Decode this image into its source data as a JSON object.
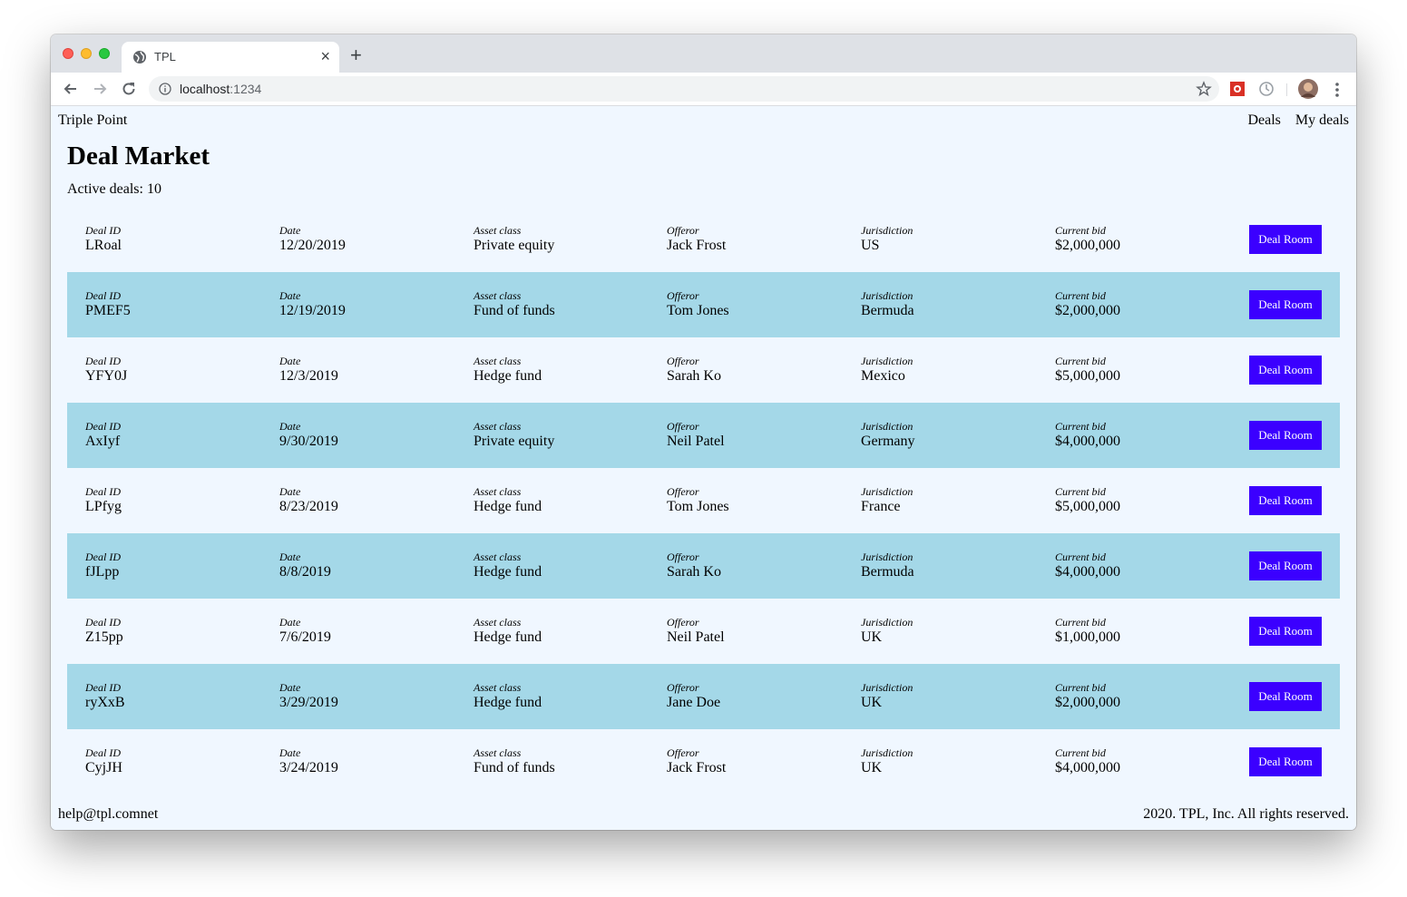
{
  "browser": {
    "tab_title": "TPL",
    "tab_close": "×",
    "new_tab": "+",
    "url_host": "localhost",
    "url_port": ":1234"
  },
  "page": {
    "brand": "Triple Point",
    "nav": [
      "Deals",
      "My deals"
    ],
    "heading": "Deal Market",
    "active_deals": "Active deals: 10",
    "labels": {
      "deal_id": "Deal ID",
      "date": "Date",
      "asset_class": "Asset class",
      "offeror": "Offeror",
      "jurisdiction": "Jurisdiction",
      "current_bid": "Current bid"
    },
    "button_label": "Deal Room",
    "deals": [
      {
        "id": "LRoal",
        "date": "12/20/2019",
        "asset": "Private equity",
        "offeror": "Jack Frost",
        "jurisdiction": "US",
        "bid": "$2,000,000"
      },
      {
        "id": "PMEF5",
        "date": "12/19/2019",
        "asset": "Fund of funds",
        "offeror": "Tom Jones",
        "jurisdiction": "Bermuda",
        "bid": "$2,000,000"
      },
      {
        "id": "YFY0J",
        "date": "12/3/2019",
        "asset": "Hedge fund",
        "offeror": "Sarah Ko",
        "jurisdiction": "Mexico",
        "bid": "$5,000,000"
      },
      {
        "id": "AxIyf",
        "date": "9/30/2019",
        "asset": "Private equity",
        "offeror": "Neil Patel",
        "jurisdiction": "Germany",
        "bid": "$4,000,000"
      },
      {
        "id": "LPfyg",
        "date": "8/23/2019",
        "asset": "Hedge fund",
        "offeror": "Tom Jones",
        "jurisdiction": "France",
        "bid": "$5,000,000"
      },
      {
        "id": "fJLpp",
        "date": "8/8/2019",
        "asset": "Hedge fund",
        "offeror": "Sarah Ko",
        "jurisdiction": "Bermuda",
        "bid": "$4,000,000"
      },
      {
        "id": "Z15pp",
        "date": "7/6/2019",
        "asset": "Hedge fund",
        "offeror": "Neil Patel",
        "jurisdiction": "UK",
        "bid": "$1,000,000"
      },
      {
        "id": "ryXxB",
        "date": "3/29/2019",
        "asset": "Hedge fund",
        "offeror": "Jane Doe",
        "jurisdiction": "UK",
        "bid": "$2,000,000"
      },
      {
        "id": "CyjJH",
        "date": "3/24/2019",
        "asset": "Fund of funds",
        "offeror": "Jack Frost",
        "jurisdiction": "UK",
        "bid": "$4,000,000"
      }
    ],
    "footer_email": "help@tpl.comnet",
    "footer_copyright": "2020. TPL, Inc. All rights reserved."
  },
  "colors": {
    "page_bg": "#f0f7ff",
    "alt_row": "#a4d8e8",
    "button": "#3b00ff"
  }
}
